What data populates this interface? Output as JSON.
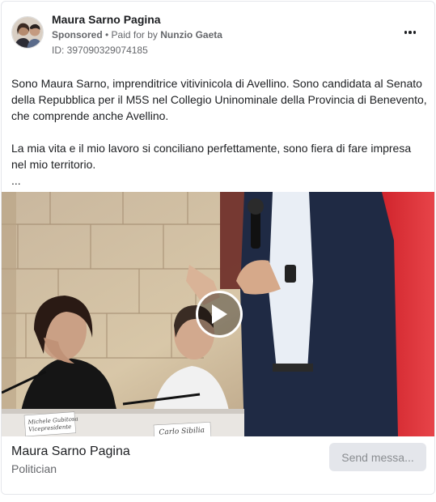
{
  "header": {
    "page_name": "Maura Sarno Pagina",
    "sponsored_label": "Sponsored",
    "separator": " • ",
    "paid_for_prefix": "Paid for by ",
    "paid_for_name": "Nunzio Gaeta",
    "ad_id": "ID: 397090329074185",
    "more_icon": "more-horizontal-icon"
  },
  "body": {
    "paragraph_1": "Sono Maura Sarno, imprenditrice vitivinicola di Avellino. Sono candidata al Senato della Repubblica per il M5S nel Collegio Uninominale della Provincia di Benevento, che comprende anche Avellino.",
    "paragraph_2": "La mia vita e il mio lavoro si conciliano perfettamente, sono fiera di fare impresa nel mio territorio.",
    "ellipsis": "..."
  },
  "media": {
    "play_icon": "play-icon",
    "name_card_1_line_1": "Michele Gubitosa",
    "name_card_1_line_2": "Vicepresidente",
    "name_card_2": "Carlo Sibilia"
  },
  "footer": {
    "page_name": "Maura Sarno Pagina",
    "category": "Politician",
    "send_button_label": "Send messa..."
  },
  "colors": {
    "text_primary": "#1c1e21",
    "text_secondary": "#65676b",
    "button_bg": "#e4e6eb",
    "button_text": "#8a8d91",
    "stage_red": "#c8212a"
  }
}
